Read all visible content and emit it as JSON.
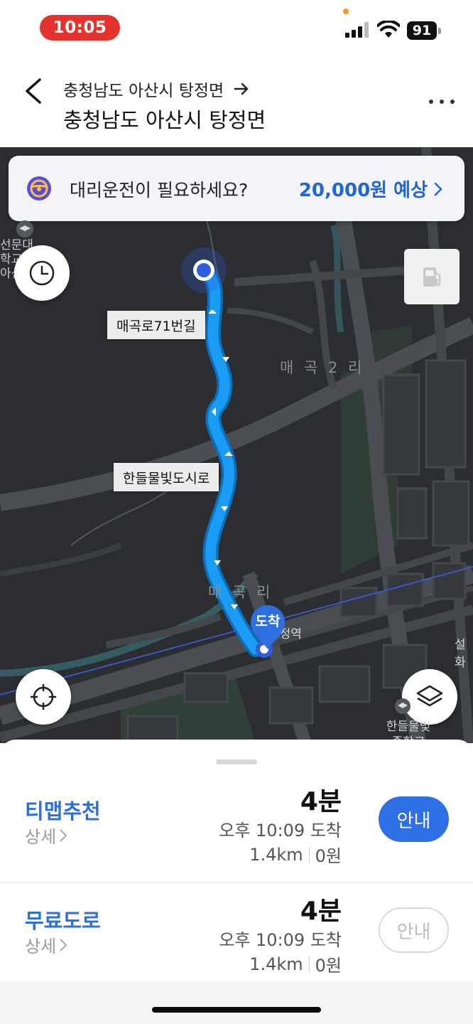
{
  "status_bar": {
    "time": "10:05",
    "battery": "91",
    "accent_colors": {
      "time_pill": "#e5322c",
      "recording_dot": "#f39a2c"
    }
  },
  "header": {
    "from": "충청남도 아산시 탕정면",
    "to": "충청남도 아산시 탕정면",
    "icons": {
      "back": "chevron-left-icon",
      "arrow": "arrow-right-icon",
      "more": "more-dots-icon"
    }
  },
  "banner": {
    "text": "대리운전이 필요하세요?",
    "cta": "20,000원 예상",
    "icon": "steering-wheel-icon"
  },
  "map": {
    "road_labels": [
      "매곡로71번길",
      "한들물빛도시로"
    ],
    "place_labels": [
      "매 곡 2 리",
      "매 곡 리"
    ],
    "small_labels": {
      "school_left": "선문대학교\n아산캠",
      "station": "탕정역",
      "right_edge": "설화",
      "school_bottom": "한들물빛\n중학교"
    },
    "arrival_marker": "도착",
    "buttons": {
      "history": "clock-icon",
      "location": "crosshair-icon",
      "layers": "layers-icon",
      "fuel": "fuel-pump-icon"
    },
    "colors": {
      "route": "#1a9cf5",
      "map_bg": "#2b2d30",
      "origin": "#2f5de0"
    }
  },
  "routes": [
    {
      "name": "티맵추천",
      "detail": "상세",
      "duration": "4분",
      "eta": "오후 10:09 도착",
      "distance": "1.4km",
      "cost": "0원",
      "guide": "안내",
      "selected": true
    },
    {
      "name": "무료도로",
      "detail": "상세",
      "duration": "4분",
      "eta": "오후 10:09 도착",
      "distance": "1.4km",
      "cost": "0원",
      "guide": "안내",
      "selected": false
    }
  ]
}
